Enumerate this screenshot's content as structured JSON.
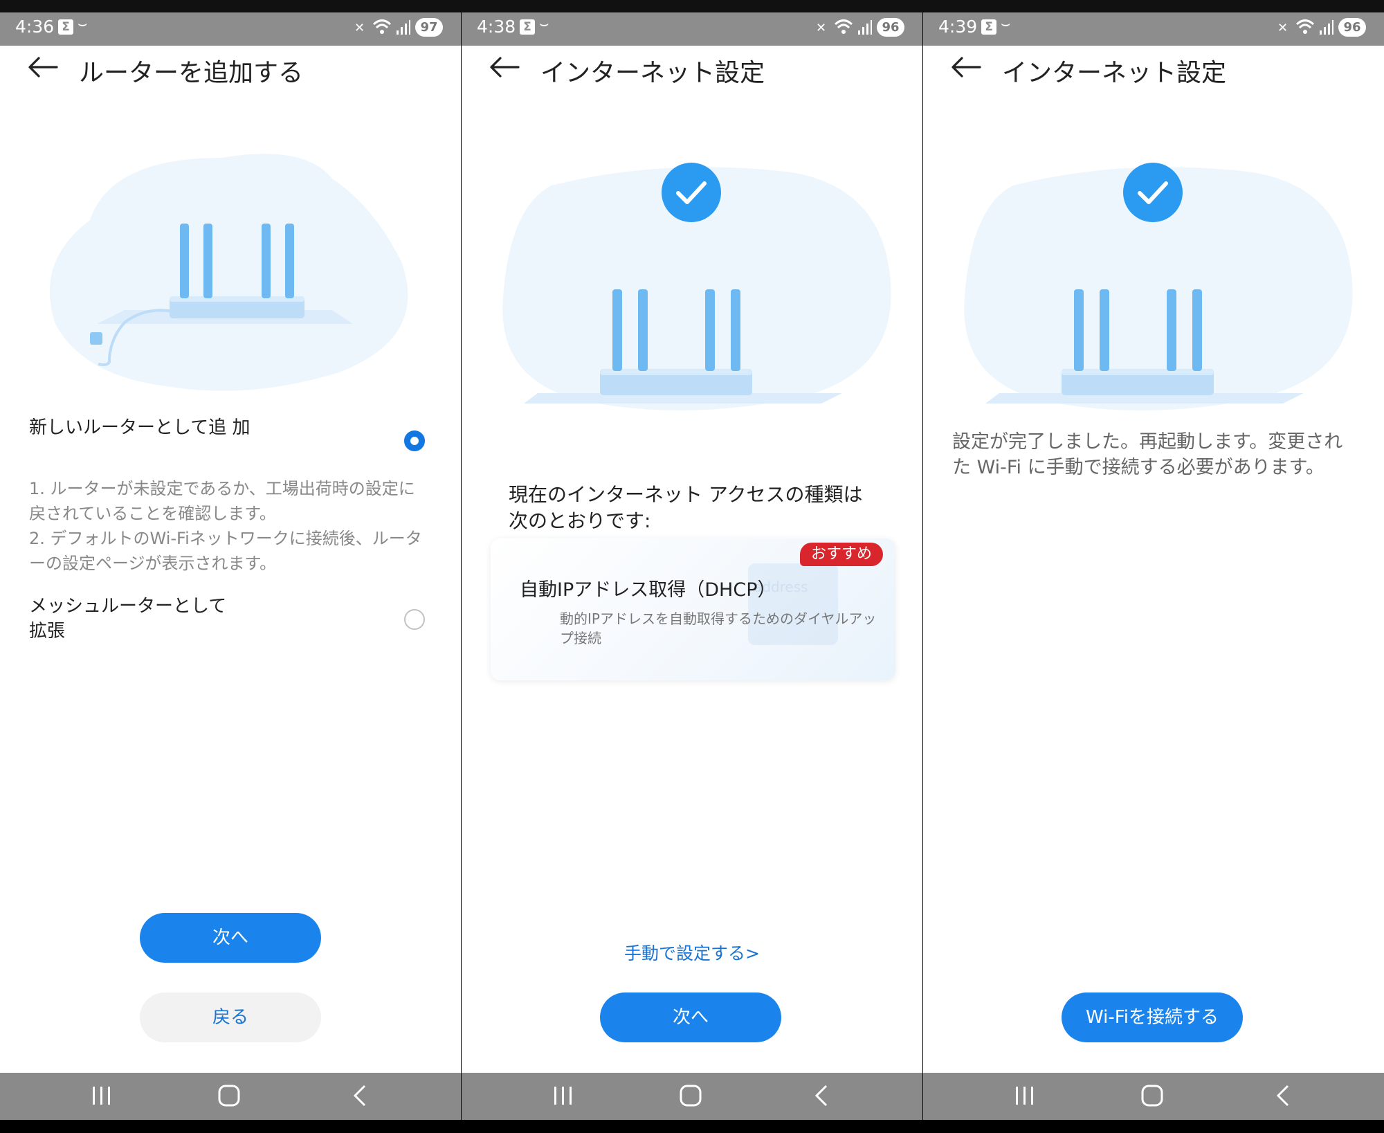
{
  "colors": {
    "accent": "#1b84ec",
    "badge": "#d9252c",
    "statusbar": "#8d8d8d"
  },
  "icons": [
    "back-arrow-icon",
    "check-icon",
    "router-illustration",
    "wifi-icon",
    "signal-icon",
    "mute-icon",
    "recents-icon",
    "home-icon",
    "nav-back-icon"
  ],
  "screens": [
    {
      "status": {
        "time": "4:36",
        "sigma": "Σ",
        "tilde": "⌣",
        "battery": "97"
      },
      "title": "ルーターを追加する",
      "options": [
        {
          "label": "新しいルーターとして追\n加",
          "selected": true
        },
        {
          "label": "メッシュルーターとして\n拡張",
          "selected": false
        }
      ],
      "description": "1. ルーターが未設定であるか、工場出荷時の設定に戻されていることを確認します。\n2. デフォルトのWi-Fiネットワークに接続後、ルーターの設定ページが表示されます。",
      "next_button": "次へ",
      "back_button": "戻る"
    },
    {
      "status": {
        "time": "4:38",
        "sigma": "Σ",
        "tilde": "⌣",
        "battery": "96"
      },
      "title": "インターネット設定",
      "access_text": "現在のインターネット アクセスの種類は次のとおりです:",
      "card": {
        "badge": "おすすめ",
        "title": "自動IPアドレス取得（DHCP）",
        "description": "動的IPアドレスを自動取得するためのダイヤルアップ接続",
        "ghost_text": "address"
      },
      "manual_link": "手動で設定する>",
      "next_button": "次へ"
    },
    {
      "status": {
        "time": "4:39",
        "sigma": "Σ",
        "tilde": "⌣",
        "battery": "96"
      },
      "title": "インターネット設定",
      "complete_text": "設定が完了しました。再起動します。変更された Wi-Fi に手動で接続する必要があります。",
      "connect_button": "Wi-Fiを接続する"
    }
  ]
}
